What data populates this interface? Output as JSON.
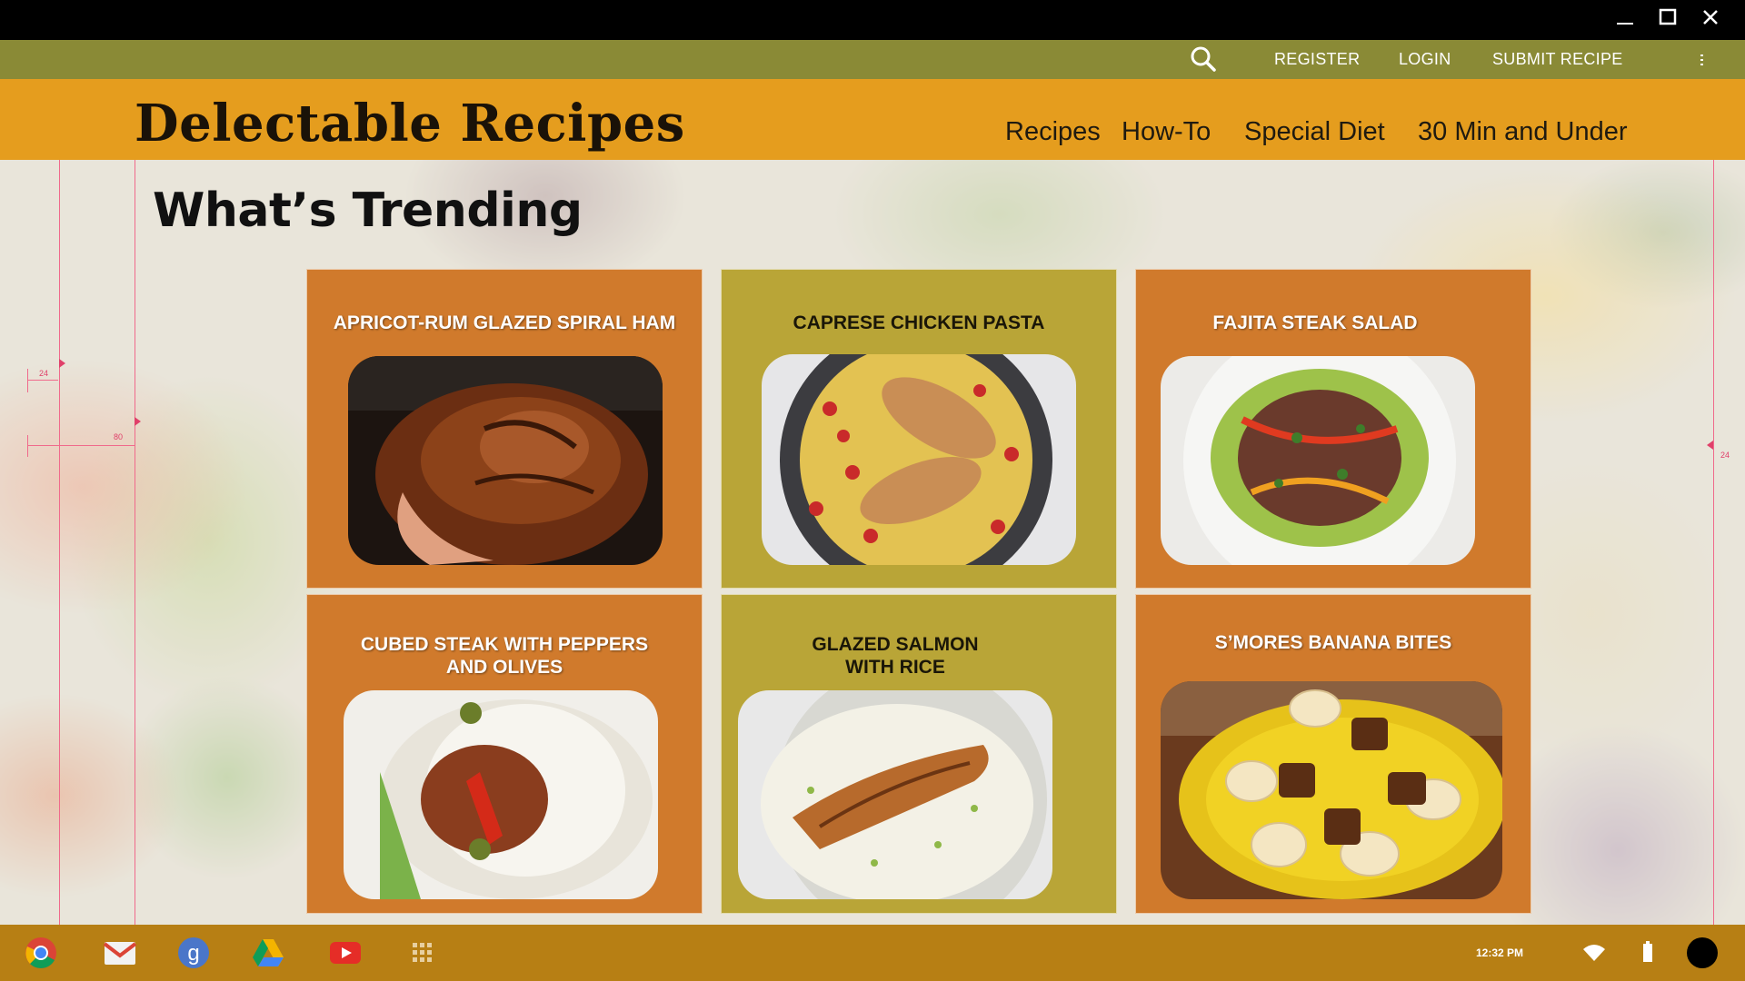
{
  "window": {
    "minimize_icon": "minimize-icon",
    "maximize_icon": "maximize-icon",
    "close_icon": "close-icon"
  },
  "utility_bar": {
    "search_icon": "search-icon",
    "register_label": "REGISTER",
    "login_label": "LOGIN",
    "submit_recipe_label": "SUBMIT RECIPE",
    "more_icon": "kebab-menu-icon"
  },
  "header": {
    "site_title": "Delectable Recipes",
    "nav": [
      {
        "label": "Recipes"
      },
      {
        "label": "How-To"
      },
      {
        "label": "Special Diet"
      },
      {
        "label": "30 Min and Under"
      }
    ]
  },
  "main": {
    "section_title": "What’s Trending",
    "recipes": [
      {
        "title": "APRICOT-RUM GLAZED SPIRAL HAM",
        "theme": "orange"
      },
      {
        "title": "CAPRESE CHICKEN PASTA",
        "theme": "olive"
      },
      {
        "title": "FAJITA STEAK SALAD",
        "theme": "orange"
      },
      {
        "title_line1": "CUBED STEAK WITH PEPPERS",
        "title_line2": "AND OLIVES",
        "theme": "orange"
      },
      {
        "title_line1": "GLAZED SALMON",
        "title_line2": "WITH RICE",
        "theme": "olive"
      },
      {
        "title": "S’MORES BANANA BITES",
        "theme": "orange"
      }
    ]
  },
  "guides": {
    "label_24_left": "24",
    "label_80": "80",
    "label_24_right": "24"
  },
  "shelf": {
    "apps": [
      {
        "icon": "chrome-icon"
      },
      {
        "icon": "gmail-icon"
      },
      {
        "icon": "google-search-icon"
      },
      {
        "icon": "drive-icon"
      },
      {
        "icon": "youtube-icon"
      },
      {
        "icon": "app-launcher-icon"
      }
    ],
    "time": "12:32 PM",
    "wifi_icon": "wifi-icon",
    "battery_icon": "battery-icon",
    "avatar_icon": "account-avatar-icon"
  },
  "colors": {
    "utility_bar": "#8a8a36",
    "header": "#e59d1e",
    "card_orange": "#d07a2c",
    "card_olive": "#b9a537",
    "shelf": "#b77f14",
    "guide": "#f06a8c"
  }
}
